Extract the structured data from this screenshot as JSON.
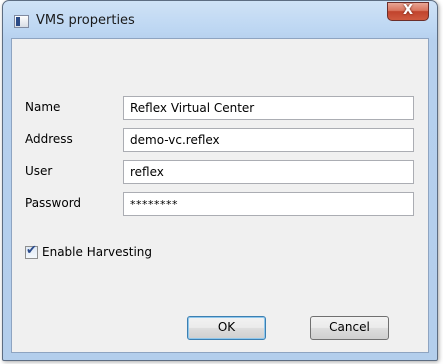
{
  "window": {
    "title": "VMS properties",
    "close_glyph": "X",
    "icon": "app-window-icon"
  },
  "form": {
    "name": {
      "label": "Name",
      "value": "Reflex Virtual Center"
    },
    "address": {
      "label": "Address",
      "value": "demo-vc.reflex"
    },
    "user": {
      "label": "User",
      "value": "reflex"
    },
    "password": {
      "label": "Password",
      "value": "********"
    }
  },
  "harvesting": {
    "label": "Enable Harvesting",
    "checked": true,
    "check_glyph": "✔"
  },
  "buttons": {
    "ok": "OK",
    "cancel": "Cancel"
  },
  "colors": {
    "titlebar": "#bcd6f2",
    "close_button": "#c0432d",
    "client_bg": "#f0f0f0",
    "default_button_border": "#3c7fb1"
  }
}
